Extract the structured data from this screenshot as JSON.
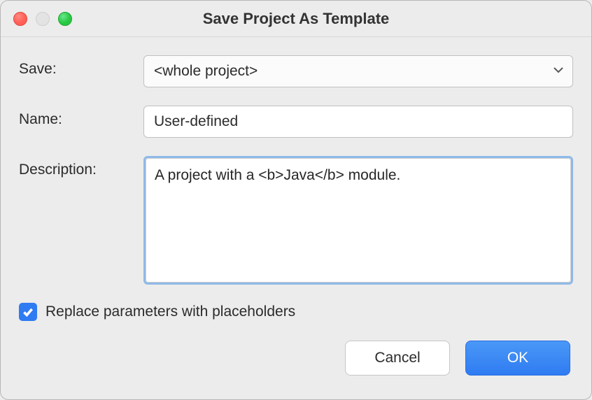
{
  "window": {
    "title": "Save Project As Template"
  },
  "form": {
    "save": {
      "label": "Save:",
      "value": "<whole project>"
    },
    "name": {
      "label": "Name:",
      "value": "User-defined"
    },
    "description": {
      "label": "Description:",
      "value": "A project with a <b>Java</b> module."
    },
    "replace": {
      "checked": true,
      "label": "Replace parameters with placeholders"
    }
  },
  "buttons": {
    "cancel": "Cancel",
    "ok": "OK"
  }
}
